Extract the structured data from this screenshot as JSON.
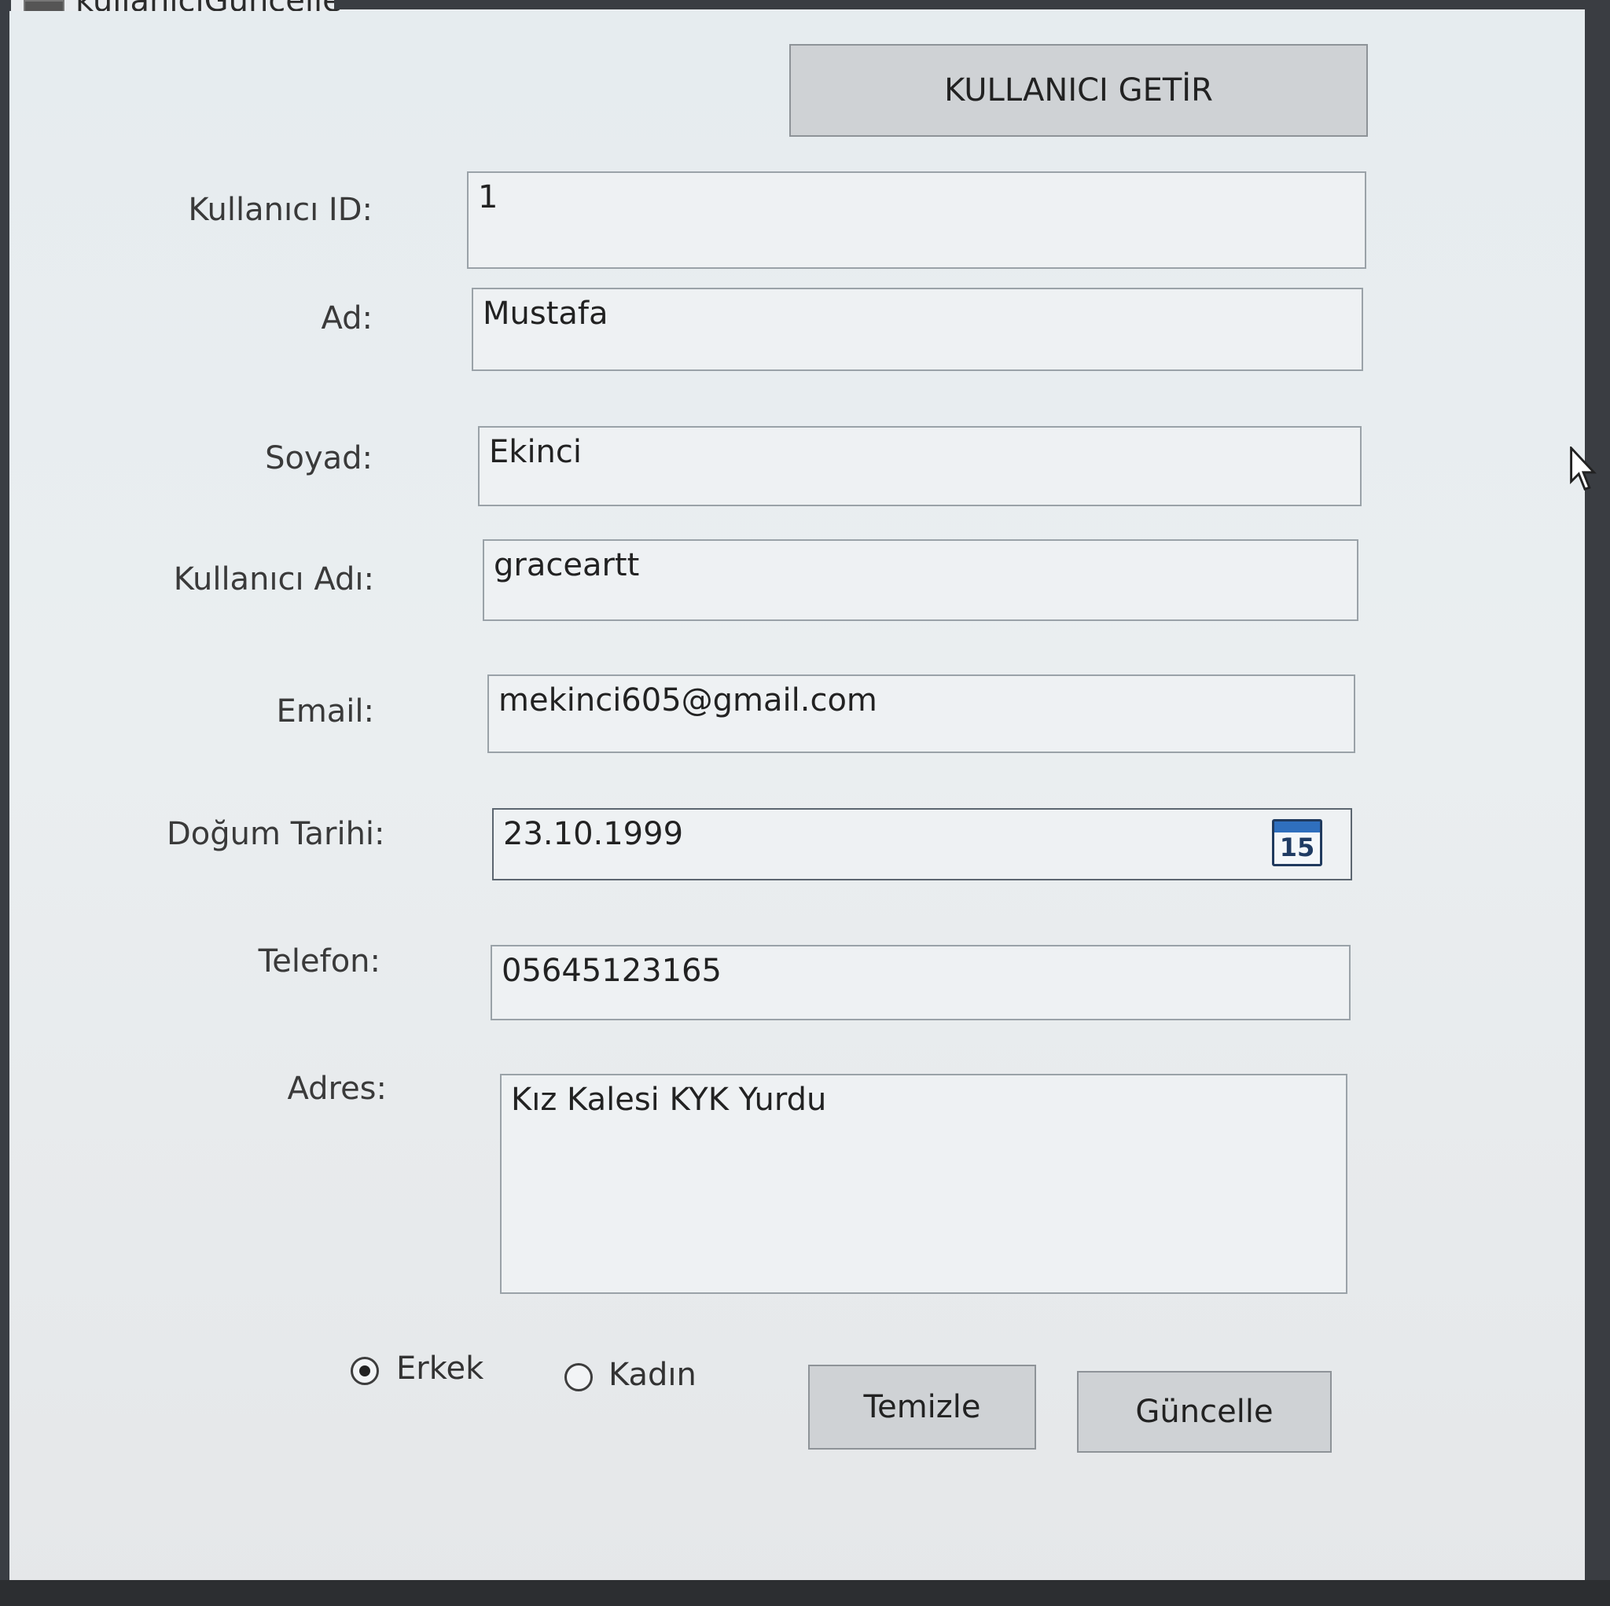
{
  "window": {
    "title": "kullaniciGuncelle"
  },
  "buttons": {
    "get_user": "KULLANICI GETİR",
    "clear": "Temizle",
    "update": "Güncelle"
  },
  "fields": {
    "user_id": {
      "label": "Kullanıcı ID:",
      "value": "1"
    },
    "first_name": {
      "label": "Ad:",
      "value": "Mustafa"
    },
    "last_name": {
      "label": "Soyad:",
      "value": "Ekinci"
    },
    "username": {
      "label": "Kullanıcı Adı:",
      "value": "graceartt"
    },
    "email": {
      "label": "Email:",
      "value": "mekinci605@gmail.com"
    },
    "birth_date": {
      "label": "Doğum Tarihi:",
      "value": "23.10.1999",
      "calendar_icon_number": "15"
    },
    "phone": {
      "label": "Telefon:",
      "value": "05645123165"
    },
    "address": {
      "label": "Adres:",
      "value": "Kız Kalesi KYK Yurdu"
    }
  },
  "gender": {
    "options": [
      {
        "label": "Erkek",
        "selected": true
      },
      {
        "label": "Kadın",
        "selected": false
      }
    ]
  },
  "icons": {
    "calendar": "calendar-icon",
    "cursor": "mouse-pointer-icon",
    "app": "window-app-icon"
  }
}
